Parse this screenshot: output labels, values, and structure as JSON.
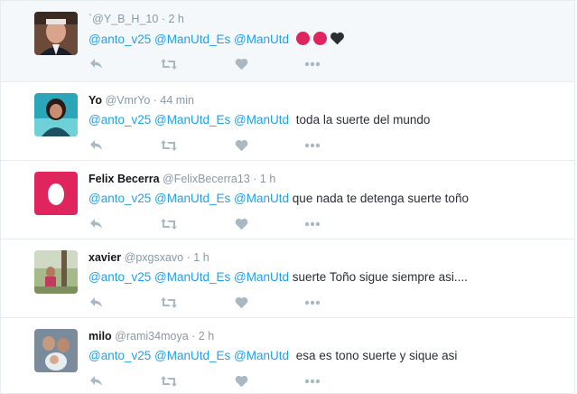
{
  "tweets": [
    {
      "fullname": "",
      "handle": "`@Y_B_H_10",
      "dot": "·",
      "time": "2 h",
      "mentions": [
        "@anto_v25",
        "@ManUtd_Es",
        "@ManUtd"
      ],
      "body": "",
      "emoji": [
        "red-circle",
        "red-circle",
        "black-heart"
      ]
    },
    {
      "fullname": "Yo",
      "handle": "@VmrYo",
      "dot": "·",
      "time": "44 min",
      "mentions": [
        "@anto_v25",
        "@ManUtd_Es",
        "@ManUtd"
      ],
      "body": "toda la suerte del mundo"
    },
    {
      "fullname": "Felix Becerra",
      "handle": "@FelixBecerra13",
      "dot": "·",
      "time": "1 h",
      "mentions": [
        "@anto_v25",
        "@ManUtd_Es",
        "@ManUtd"
      ],
      "body": "que nada te detenga suerte toño"
    },
    {
      "fullname": "xavier",
      "handle": "@pxgsxavo",
      "dot": "·",
      "time": "1 h",
      "mentions": [
        "@anto_v25",
        "@ManUtd_Es",
        "@ManUtd"
      ],
      "body": "suerte Toño sigue siempre asi...."
    },
    {
      "fullname": "milo",
      "handle": "@rami34moya",
      "dot": "·",
      "time": "2 h",
      "mentions": [
        "@anto_v25",
        "@ManUtd_Es",
        "@ManUtd"
      ],
      "body": "esa es tono suerte y sique asi"
    }
  ],
  "icons": {
    "reply": "reply-icon",
    "retweet": "retweet-icon",
    "like": "heart-icon",
    "more": "more-icon"
  },
  "colors": {
    "mention": "#1da1f2",
    "meta": "#8899a6",
    "action_icon": "#aab8c2",
    "egg": "#e0245e"
  }
}
